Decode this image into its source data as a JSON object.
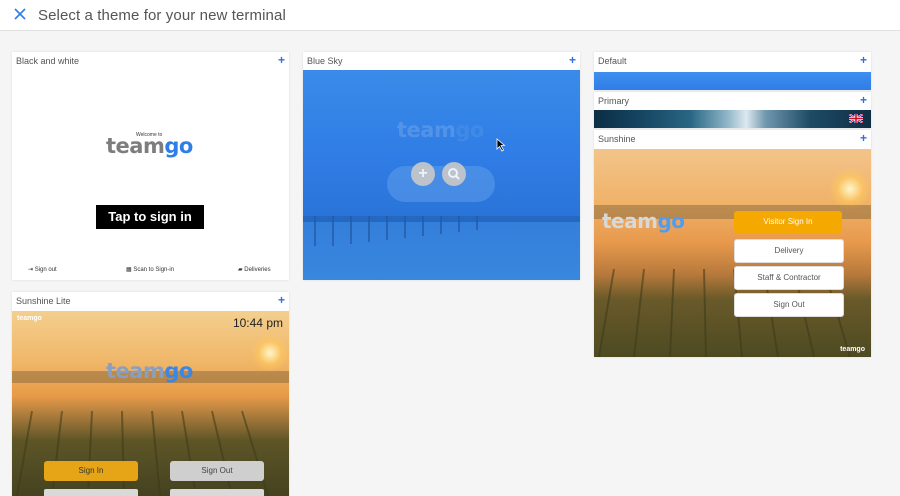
{
  "header": {
    "title": "Select a theme for your new terminal"
  },
  "themes": {
    "black_white": {
      "label": "Black and white",
      "welcome": "Welcome to",
      "logo_team": "team",
      "logo_go": "go",
      "tap_label": "Tap to sign in",
      "footer": [
        "Sign out",
        "Scan to Sign-in",
        "Deliveries"
      ]
    },
    "blue_sky": {
      "label": "Blue Sky",
      "logo_team": "team",
      "logo_go": "go",
      "overlay_color": "#2f7de6"
    },
    "default": {
      "label": "Default",
      "bar_color": "#2f7de6"
    },
    "primary": {
      "label": "Primary"
    },
    "sunshine": {
      "label": "Sunshine",
      "logo_team": "team",
      "logo_go": "go",
      "buttons": [
        "Visitor Sign In",
        "Delivery",
        "Staff & Contractor",
        "Sign Out"
      ],
      "accent": "#f5a800",
      "corner_logo": "teamgo"
    },
    "sunshine_lite": {
      "label": "Sunshine Lite",
      "corner_logo": "teamgo",
      "time": "10:44 pm",
      "logo_team": "team",
      "logo_go": "go",
      "btn_sign_in": "Sign In",
      "btn_sign_out": "Sign Out"
    }
  },
  "icons": {
    "add": "plus-icon",
    "close": "close-icon"
  },
  "add_symbol": "+"
}
